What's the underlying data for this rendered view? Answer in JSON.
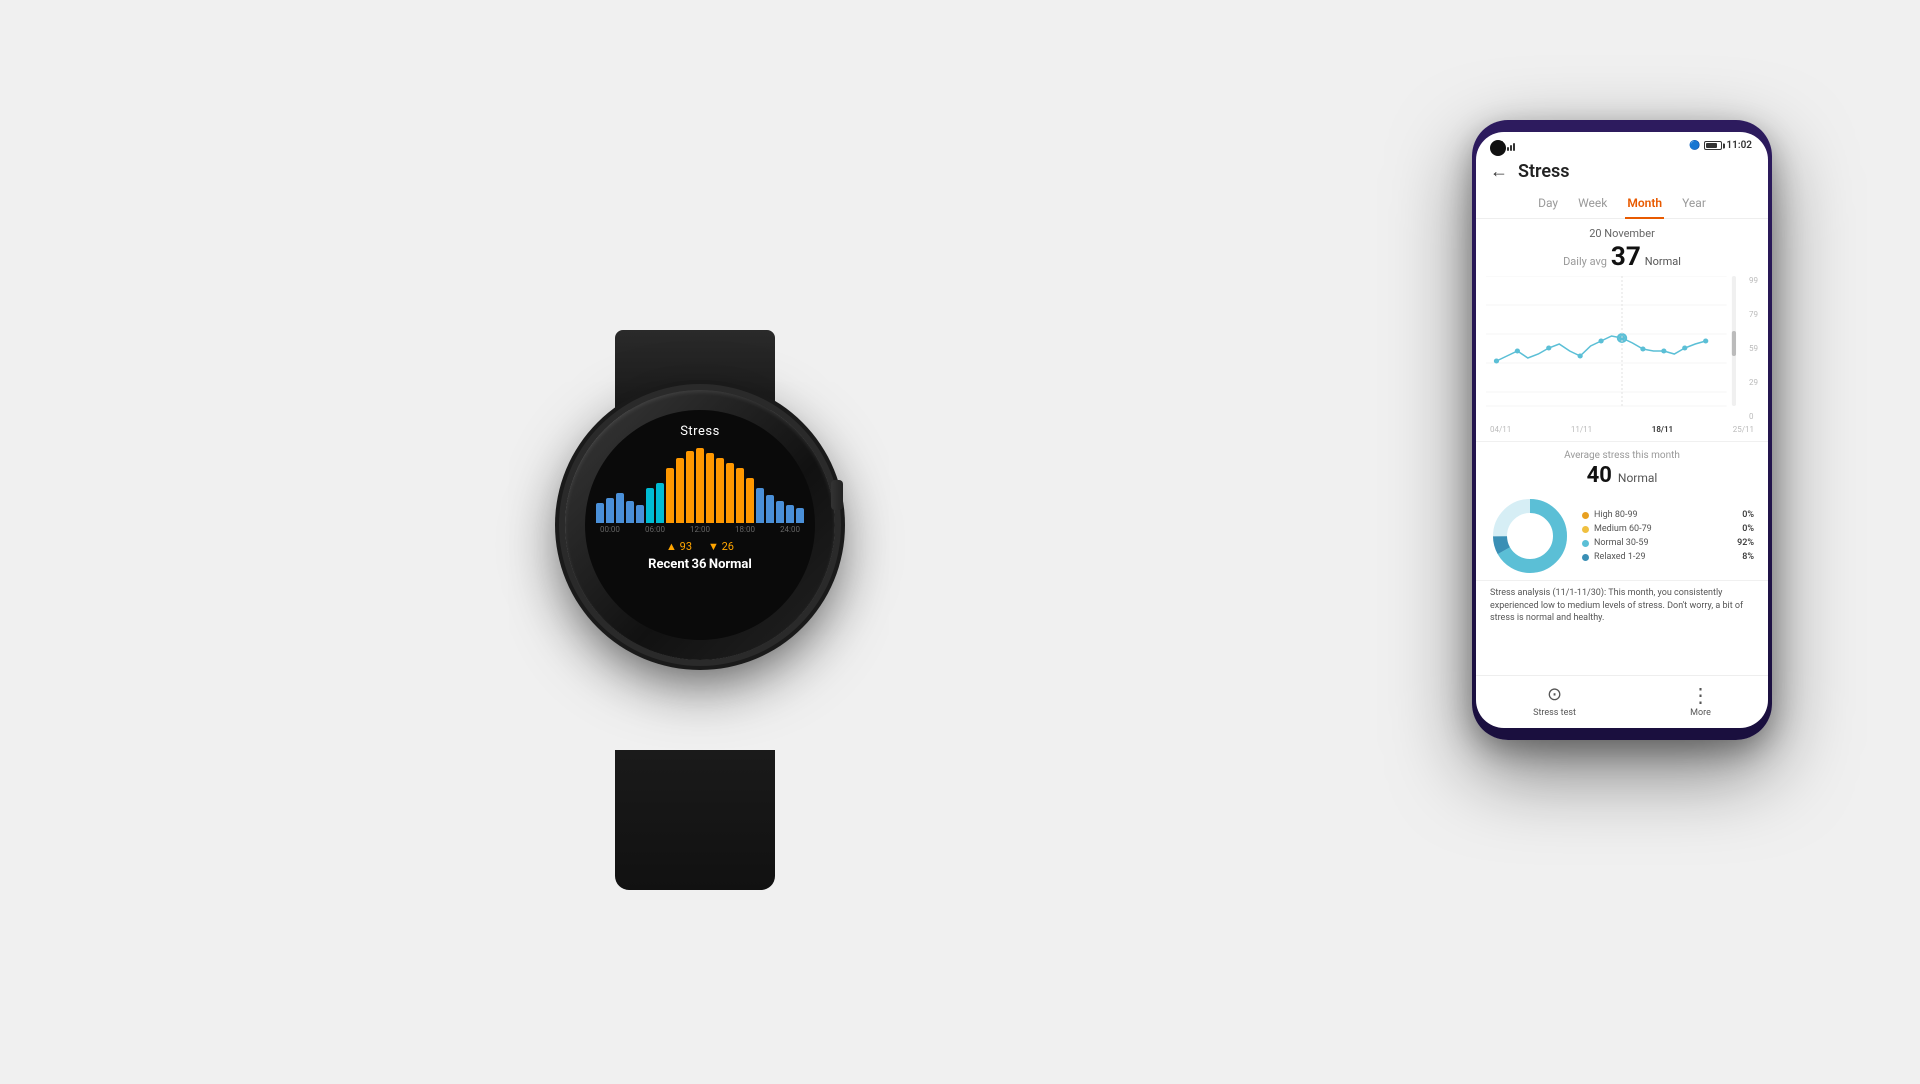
{
  "background": "#efefef",
  "phone": {
    "statusBar": {
      "signal1": "signal",
      "signal2": "wifi",
      "bluetooth": "BT",
      "battery": "11:02"
    },
    "header": {
      "backLabel": "←",
      "title": "Stress"
    },
    "tabs": [
      {
        "label": "Day",
        "active": false
      },
      {
        "label": "Week",
        "active": false
      },
      {
        "label": "Month",
        "active": true
      },
      {
        "label": "Year",
        "active": false
      }
    ],
    "date": "20 November",
    "dailyAvgLabel": "Daily avg",
    "dailyAvgValue": "37",
    "dailyAvgStatus": "Normal",
    "chartYLabels": [
      "99",
      "79",
      "59",
      "29",
      "0"
    ],
    "chartXLabels": [
      "04/11",
      "11/11",
      "18/11",
      "25/11"
    ],
    "chartActiveLabel": "18/11",
    "avgSection": {
      "title": "Average stress this month",
      "value": "40",
      "status": "Normal"
    },
    "legend": [
      {
        "label": "High 80-99",
        "color": "#e8a020",
        "pct": "0%"
      },
      {
        "label": "Medium 60-79",
        "color": "#f0c040",
        "pct": "0%"
      },
      {
        "label": "Normal 30-59",
        "color": "#5bbfd6",
        "pct": "92%"
      },
      {
        "label": "Relaxed 1-29",
        "color": "#3a8fb5",
        "pct": "8%"
      }
    ],
    "analysis": "Stress analysis (11/1-11/30): This month, you consistently experienced low to medium levels of stress. Don't worry, a bit of stress is normal and healthy.",
    "bottomNav": [
      {
        "label": "Stress test",
        "icon": "⊙"
      },
      {
        "label": "More",
        "icon": "⋮"
      }
    ]
  },
  "watch": {
    "title": "Stress",
    "timeLabels": [
      "00:00",
      "06:00",
      "12:00",
      "18:00",
      "24:00"
    ],
    "metric1Label": "▲ 93",
    "metric2Label": "▼ 26",
    "recentLabel": "Recent",
    "recentValue": "36",
    "recentStatus": "Normal"
  }
}
